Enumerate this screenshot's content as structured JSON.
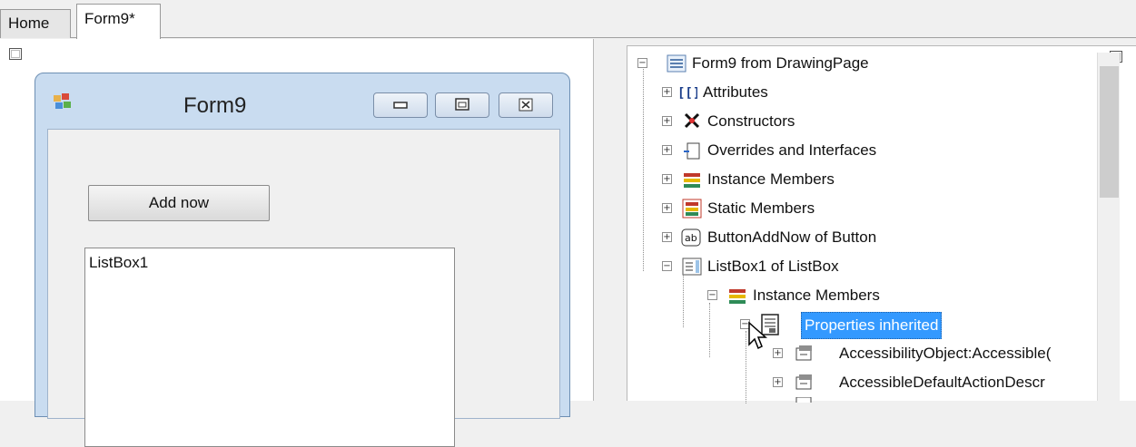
{
  "tabs": [
    {
      "label": "Home"
    },
    {
      "label": "Form9*"
    }
  ],
  "form": {
    "title": "Form9",
    "button_label": "Add now",
    "listbox_label": "ListBox1"
  },
  "tree": {
    "root": "Form9 from DrawingPage",
    "items": [
      "Attributes",
      "Constructors",
      "Overrides and Interfaces",
      "Instance Members",
      "Static Members",
      "ButtonAddNow of Button",
      "ListBox1 of ListBox",
      "Instance Members",
      "Properties inherited",
      "AccessibilityObject:Accessible(",
      "AccessibleDefaultActionDescr"
    ]
  },
  "colors": {
    "selection": "#3399ff",
    "window_frame": "#c9dcf0"
  }
}
